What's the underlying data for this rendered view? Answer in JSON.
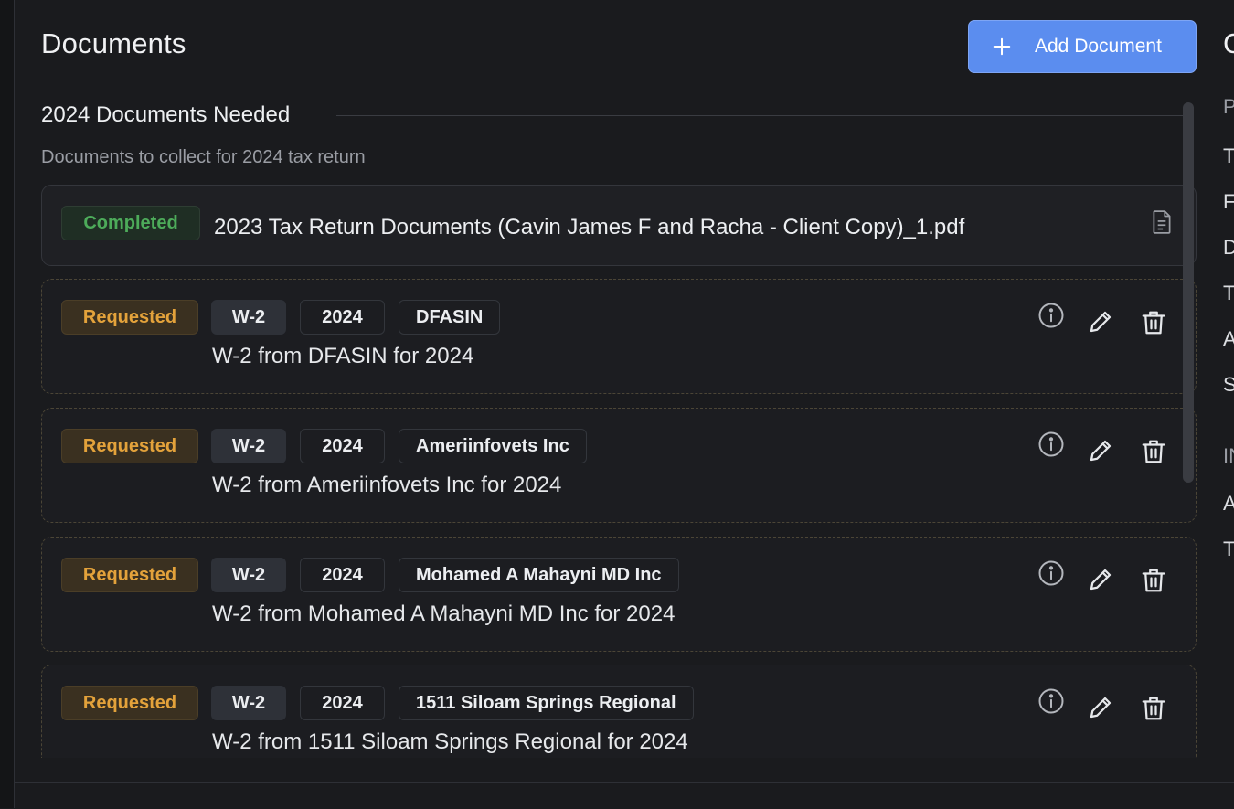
{
  "page": {
    "title": "Documents"
  },
  "toolbar": {
    "add_label": "Add Document"
  },
  "section": {
    "title": "2024 Documents Needed",
    "subtitle": "Documents to collect for 2024 tax return"
  },
  "completed_doc": {
    "status": "Completed",
    "file_name": "2023 Tax Return Documents (Cavin James F and Racha - Client Copy)_1.pdf"
  },
  "requested_docs": [
    {
      "status": "Requested",
      "type": "W-2",
      "year": "2024",
      "org": "DFASIN",
      "description": "W-2 from DFASIN for 2024"
    },
    {
      "status": "Requested",
      "type": "W-2",
      "year": "2024",
      "org": "Ameriinfovets Inc",
      "description": "W-2 from Ameriinfovets Inc for 2024"
    },
    {
      "status": "Requested",
      "type": "W-2",
      "year": "2024",
      "org": "Mohamed A Mahayni MD Inc",
      "description": "W-2 from Mohamed A Mahayni MD Inc for 2024"
    },
    {
      "status": "Requested",
      "type": "W-2",
      "year": "2024",
      "org": "1511 Siloam Springs Regional",
      "description": "W-2 from 1511 Siloam Springs Regional for 2024"
    }
  ],
  "right_panel": {
    "title_initial": "C",
    "labels": [
      "P",
      "T",
      "F",
      "D",
      "T",
      "A",
      "S",
      "IN",
      "A",
      "T"
    ]
  },
  "colors": {
    "accent": "#5b8def",
    "completed": "#4dab5a",
    "requested": "#e3a23b",
    "background": "#1a1b1e"
  },
  "icons": [
    "plus-icon",
    "document-icon",
    "info-icon",
    "edit-icon",
    "trash-icon"
  ]
}
